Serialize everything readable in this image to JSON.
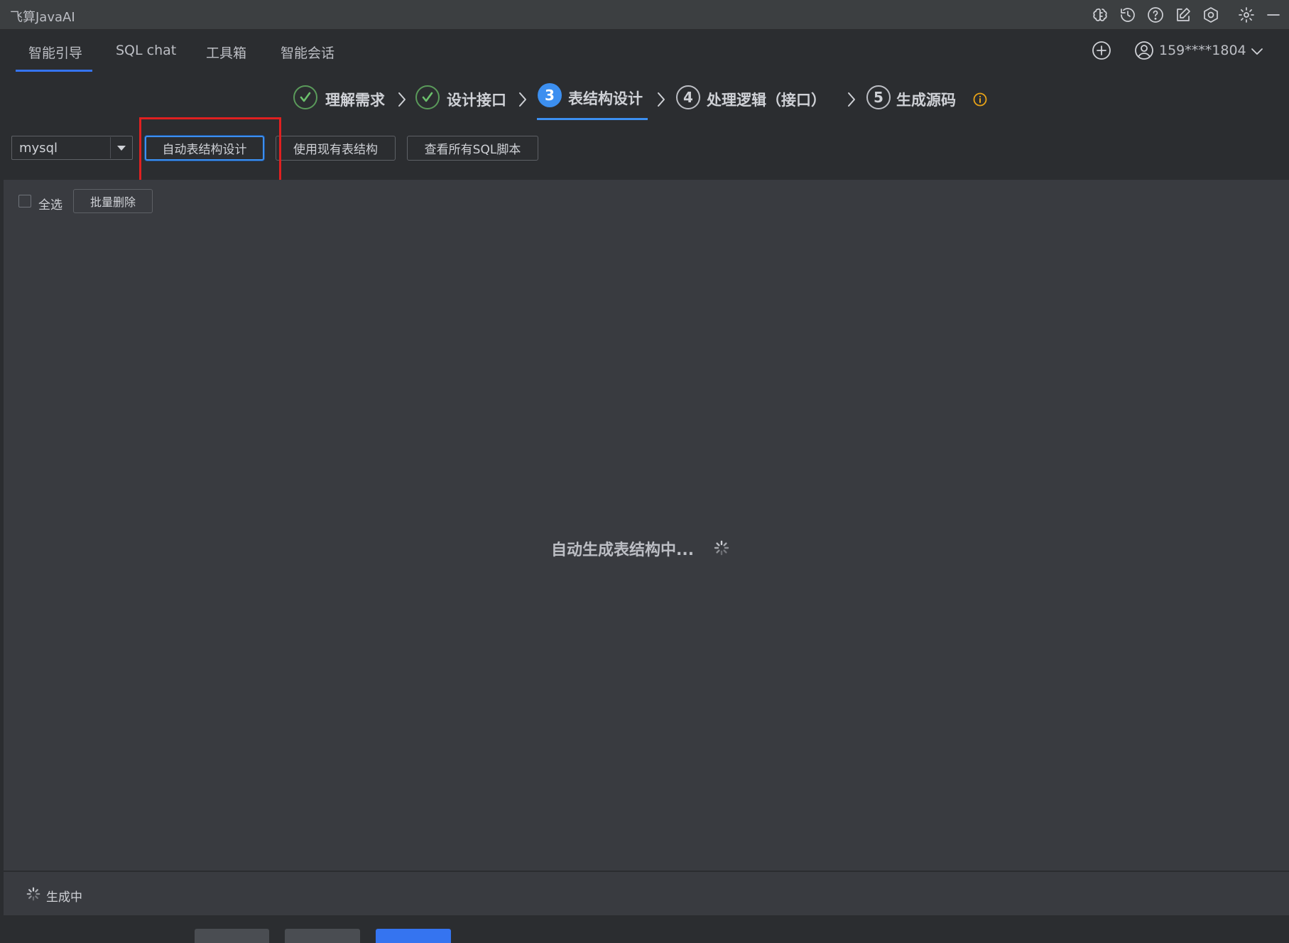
{
  "app": {
    "title": "飞算JavaAI"
  },
  "tabs": [
    {
      "label": "智能引导",
      "active": true
    },
    {
      "label": "SQL chat",
      "active": false
    },
    {
      "label": "工具箱",
      "active": false
    },
    {
      "label": "智能会话",
      "active": false
    }
  ],
  "header": {
    "user": "159****1804"
  },
  "titlebar_icons": [
    "brain-icon",
    "history-icon",
    "help-icon",
    "edit-icon",
    "shield-icon",
    "gear-icon",
    "minimize-icon"
  ],
  "steps": [
    {
      "index": "1",
      "label": "理解需求",
      "status": "done"
    },
    {
      "index": "2",
      "label": "设计接口",
      "status": "done"
    },
    {
      "index": "3",
      "label": "表结构设计",
      "status": "active"
    },
    {
      "index": "4",
      "label": "处理逻辑（接口）",
      "status": "pending"
    },
    {
      "index": "5",
      "label": "生成源码",
      "status": "pending"
    }
  ],
  "toolbar": {
    "db_type": "mysql",
    "auto_design_label": "自动表结构设计",
    "use_existing_label": "使用现有表结构",
    "view_sql_label": "查看所有SQL脚本"
  },
  "list_controls": {
    "select_all_label": "全选",
    "batch_delete_label": "批量删除"
  },
  "content": {
    "loading_text": "自动生成表结构中..."
  },
  "status": {
    "text": "生成中"
  },
  "colors": {
    "accent": "#3c8ff0",
    "done": "#6cc06c",
    "highlight": "#e02020",
    "info": "#e8a317"
  }
}
